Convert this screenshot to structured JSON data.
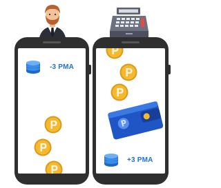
{
  "left_phone": {
    "amount_label": "-3 PMA"
  },
  "right_phone": {
    "amount_label": "+3 PMA"
  },
  "colors": {
    "phone_body": "#2f2f2f",
    "amount_text": "#1e6fd9",
    "coin": "#f5b82e",
    "wallet": "#2a62d8",
    "coin_stack": "#3a8ee6"
  },
  "icons": [
    "businessman-icon",
    "cash-register-icon",
    "coin-stack-icon",
    "coin-icon",
    "wallet-icon"
  ]
}
